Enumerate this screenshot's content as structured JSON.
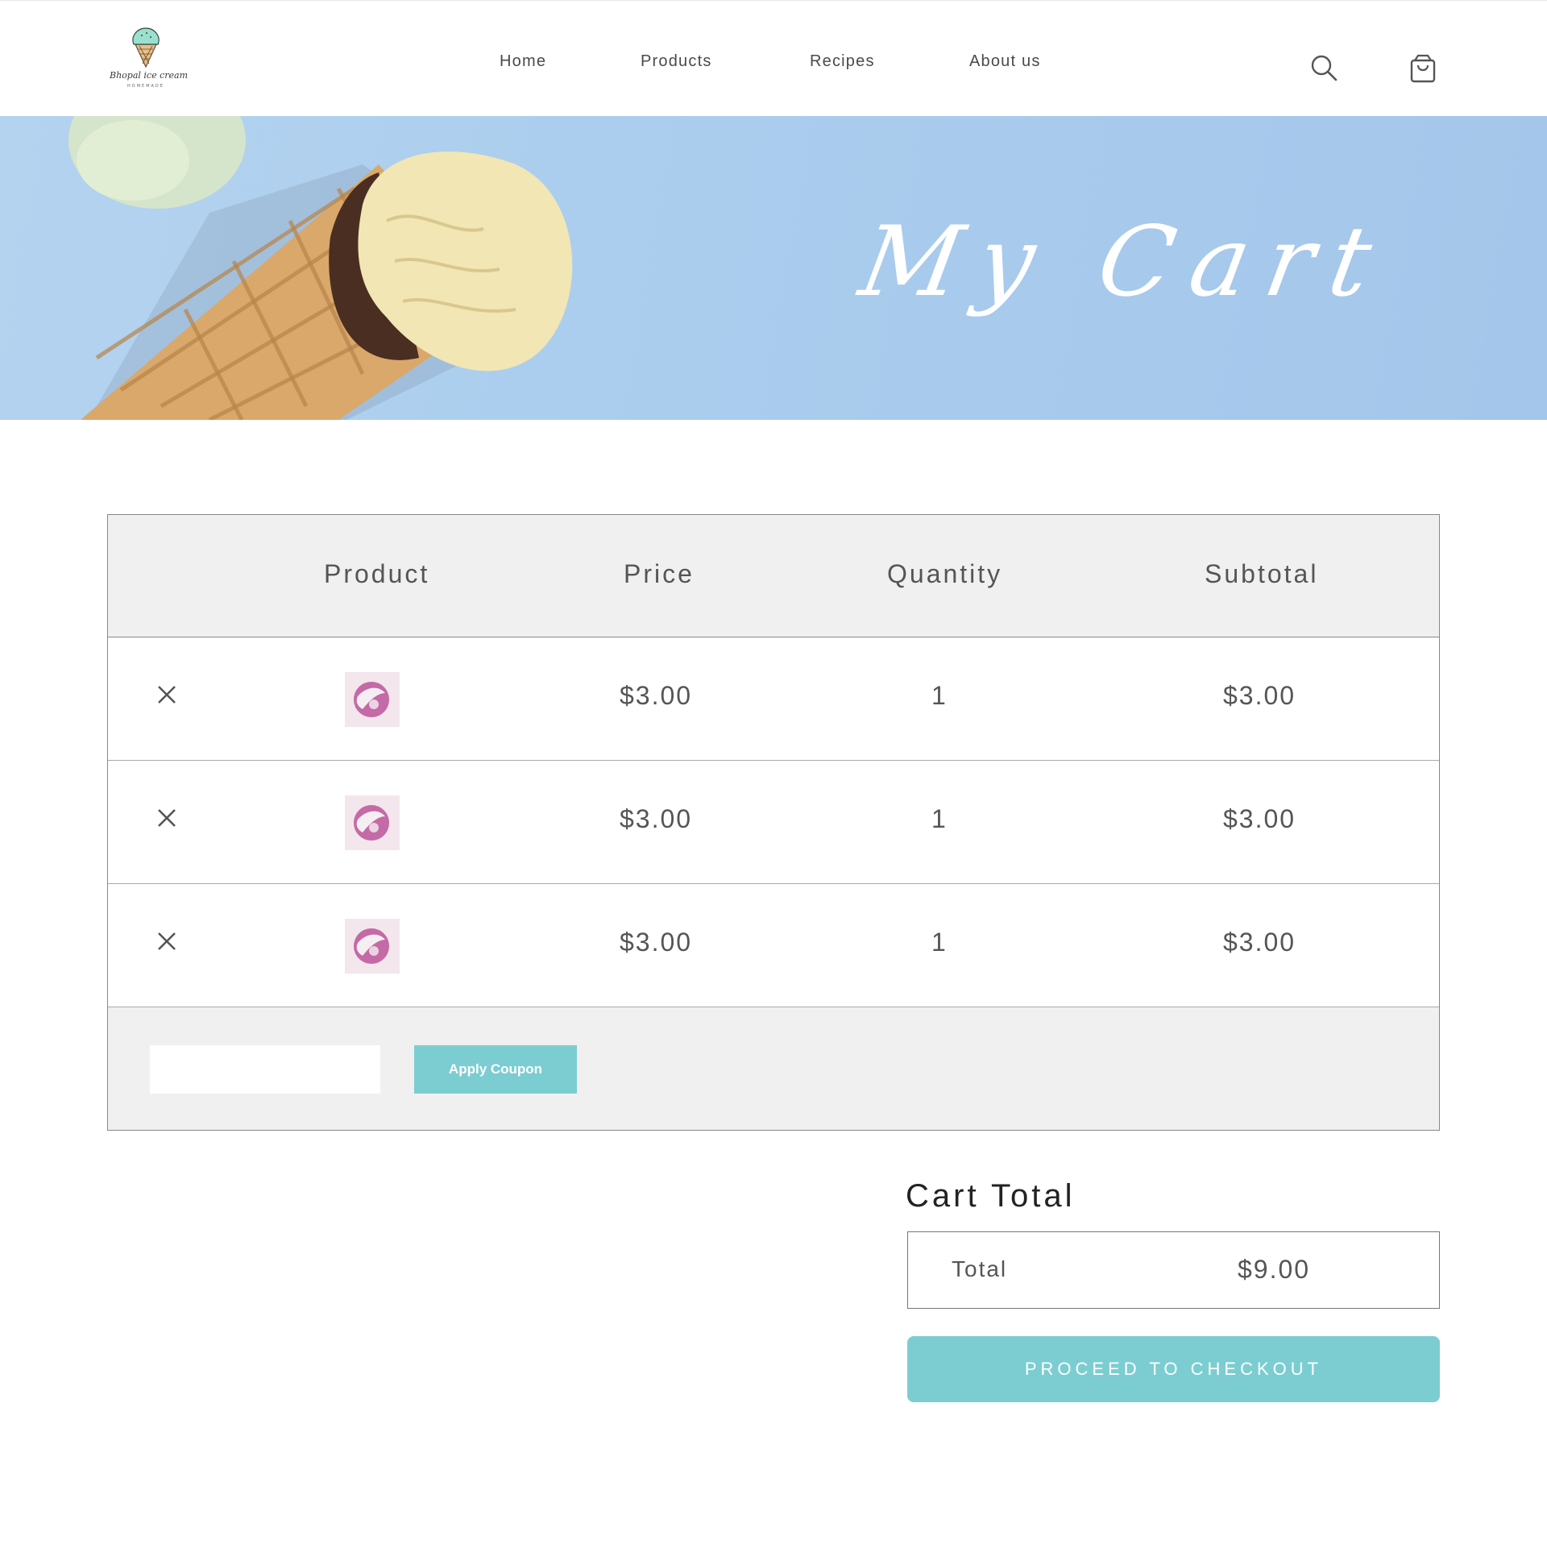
{
  "header": {
    "logo": {
      "brand": "Bhopal ice cream",
      "tagline": "HOMEMADE"
    },
    "nav": [
      {
        "label": "Home"
      },
      {
        "label": "Products"
      },
      {
        "label": "Recipes"
      },
      {
        "label": "About us"
      }
    ],
    "icons": {
      "search": "search-icon",
      "cart": "shopping-bag-icon"
    }
  },
  "hero": {
    "title": "My Cart"
  },
  "cart_table": {
    "headers": {
      "product": "Product",
      "price": "Price",
      "quantity": "Quantity",
      "subtotal": "Subtotal"
    },
    "rows": [
      {
        "price": "$3.00",
        "quantity": "1",
        "subtotal": "$3.00"
      },
      {
        "price": "$3.00",
        "quantity": "1",
        "subtotal": "$3.00"
      },
      {
        "price": "$3.00",
        "quantity": "1",
        "subtotal": "$3.00"
      }
    ],
    "coupon": {
      "placeholder": "",
      "button_label": "Apply Coupon"
    }
  },
  "cart_total": {
    "title": "Cart Total",
    "total_label": "Total",
    "total_value": "$9.00",
    "checkout_label": "PROCEED TO CHECKOUT"
  },
  "colors": {
    "accent": "#7ccdd1",
    "hero_bg": "#aacdee",
    "table_header_bg": "#f0f0f0"
  }
}
